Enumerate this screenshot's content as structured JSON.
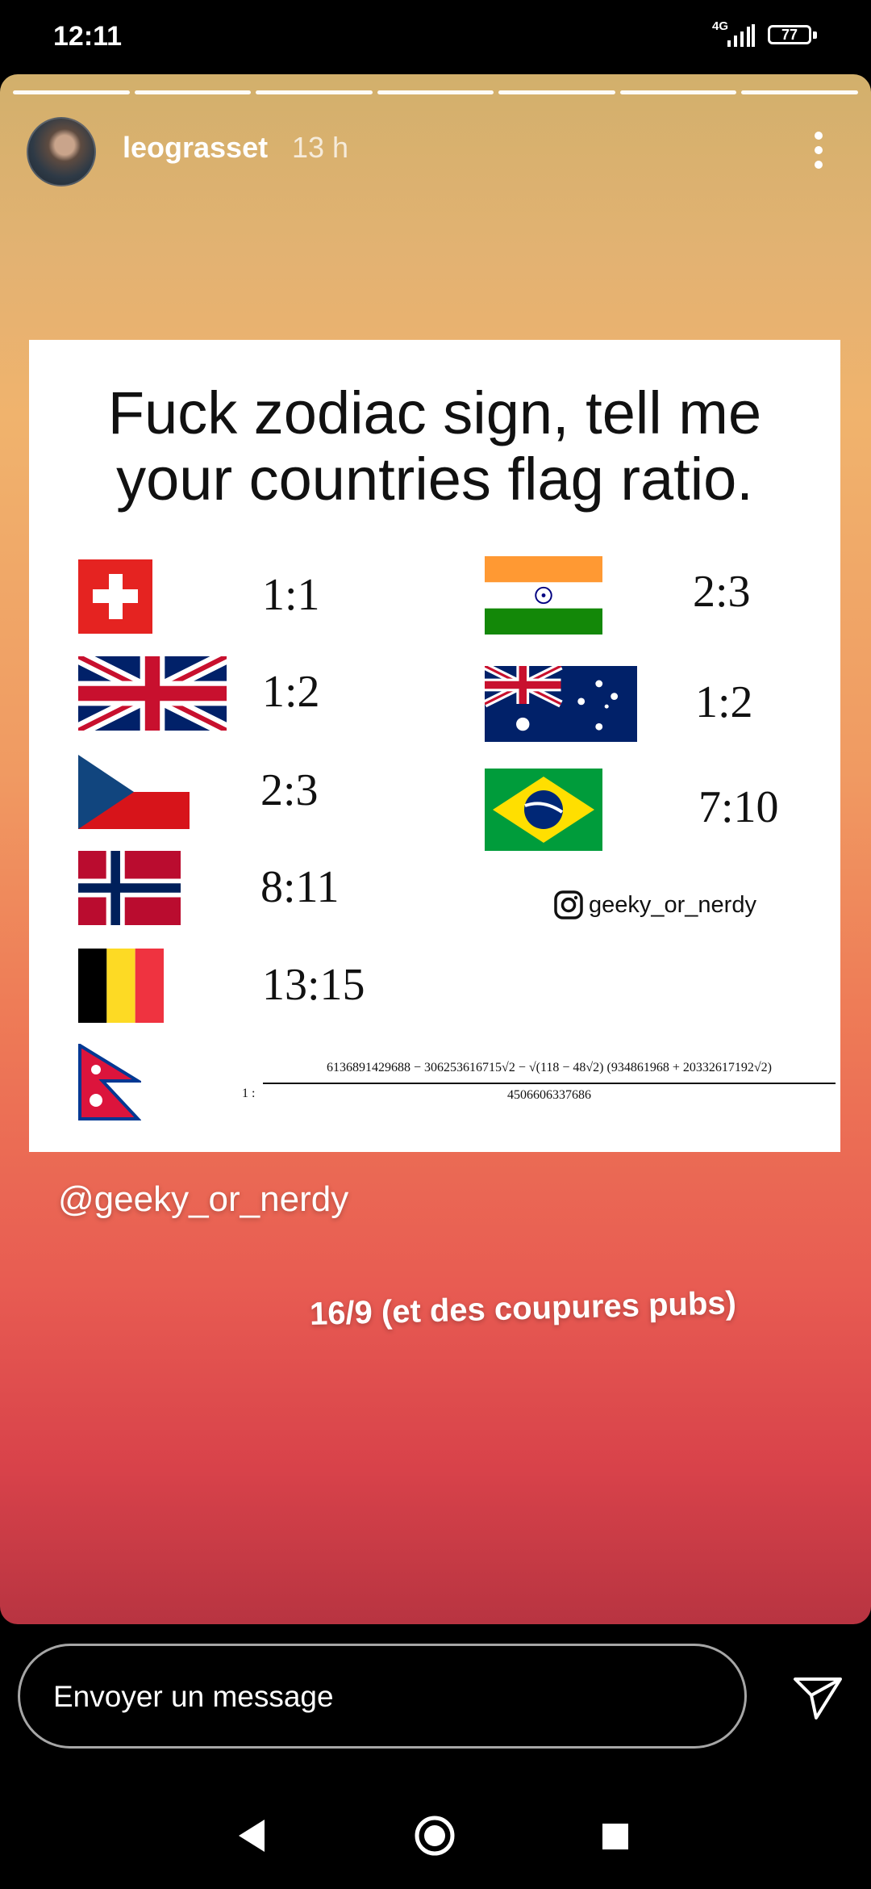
{
  "status_bar": {
    "time": "12:11",
    "network": "4G",
    "battery": "77"
  },
  "story": {
    "username": "leograsset",
    "time_ago": "13 h",
    "progress_segments": 7,
    "meme": {
      "title_line1": "Fuck zodiac sign, tell me",
      "title_line2": "your countries flag ratio.",
      "flags": [
        {
          "country": "Switzerland",
          "ratio": "1:1"
        },
        {
          "country": "United Kingdom",
          "ratio": "1:2"
        },
        {
          "country": "Czech Republic",
          "ratio": "2:3"
        },
        {
          "country": "Norway",
          "ratio": "8:11"
        },
        {
          "country": "Belgium",
          "ratio": "13:15"
        },
        {
          "country": "India",
          "ratio": "2:3"
        },
        {
          "country": "Australia",
          "ratio": "1:2"
        },
        {
          "country": "Brazil",
          "ratio": "7:10"
        }
      ],
      "nepal": {
        "prefix": "1 :",
        "numerator": "6136891429688 − 306253616715√2 − √(118 − 48√2) (934861968 + 20332617192√2)",
        "denominator": "4506606337686"
      },
      "handle": "geeky_or_nerdy"
    },
    "mention": "@geeky_or_nerdy",
    "caption": "16/9 (et des coupures pubs)"
  },
  "reply": {
    "placeholder": "Envoyer un message"
  }
}
